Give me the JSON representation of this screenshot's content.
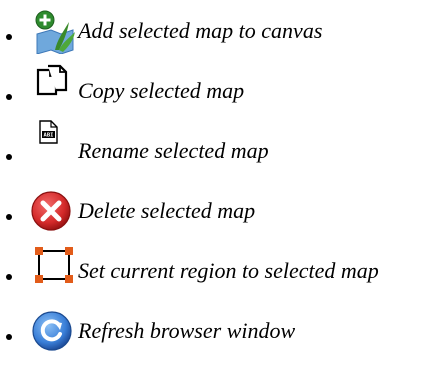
{
  "items": [
    {
      "icon": "add-map-icon",
      "label": "Add selected map to canvas"
    },
    {
      "icon": "copy-icon",
      "label": "Copy selected map"
    },
    {
      "icon": "rename-icon",
      "label": "Rename selected map"
    },
    {
      "icon": "delete-icon",
      "label": "Delete selected map"
    },
    {
      "icon": "region-icon",
      "label": "Set current region to selected map"
    },
    {
      "icon": "refresh-icon",
      "label": "Refresh browser window"
    }
  ],
  "colors": {
    "add_plus": "#2e8b2e",
    "add_map": "#5b9bd5",
    "add_leaf": "#3a8a2a",
    "delete_red": "#d42a2a",
    "region_orange": "#e25c1a",
    "refresh_blue": "#3a7fd8"
  }
}
